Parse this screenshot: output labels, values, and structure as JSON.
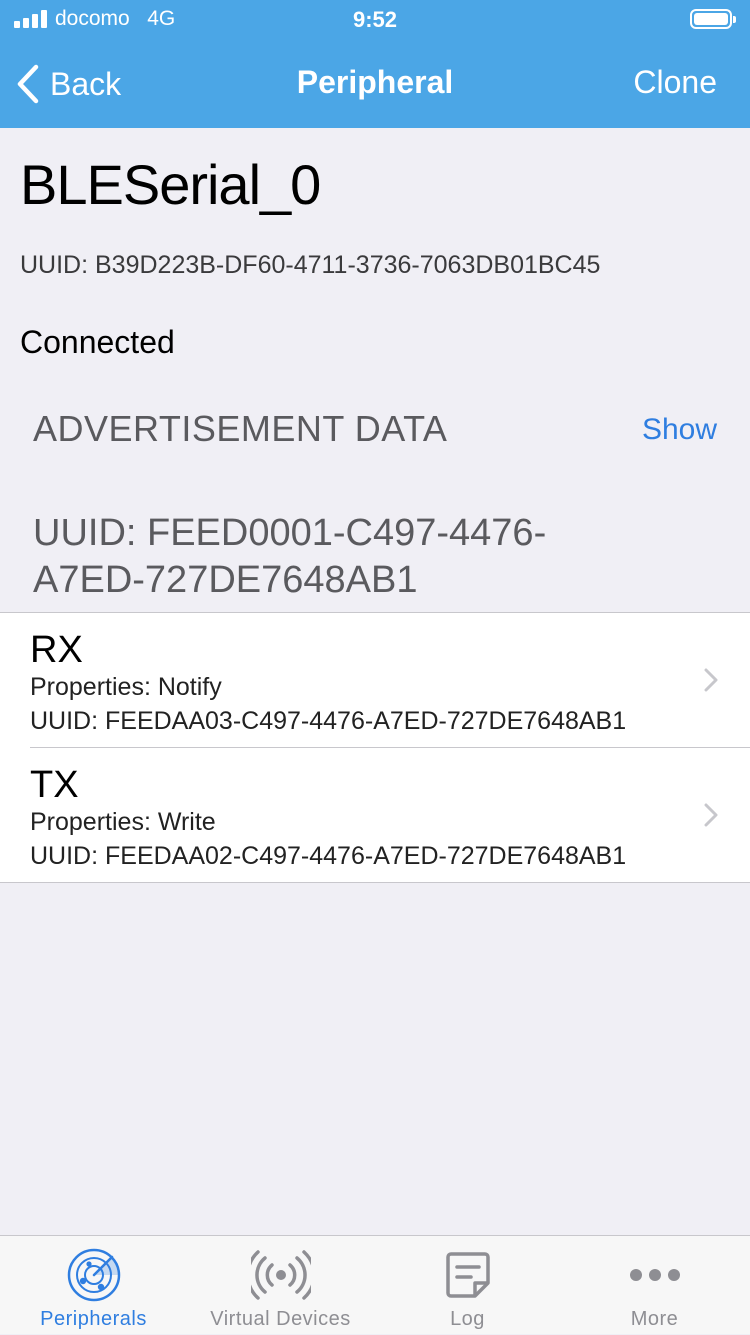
{
  "status_bar": {
    "carrier": "docomo",
    "network": "4G",
    "time": "9:52"
  },
  "nav": {
    "back_label": "Back",
    "title": "Peripheral",
    "clone_label": "Clone"
  },
  "peripheral": {
    "name": "BLESerial_0",
    "uuid": "UUID: B39D223B-DF60-4711-3736-7063DB01BC45",
    "state": "Connected"
  },
  "advertisement": {
    "label": "ADVERTISEMENT DATA",
    "show_label": "Show"
  },
  "service": {
    "uuid_line1": "UUID: FEED0001-C497-4476-",
    "uuid_line2": "A7ED-727DE7648AB1"
  },
  "characteristics": [
    {
      "name": "RX",
      "properties": "Properties: Notify",
      "uuid": "UUID: FEEDAA03-C497-4476-A7ED-727DE7648AB1"
    },
    {
      "name": "TX",
      "properties": "Properties: Write",
      "uuid": "UUID: FEEDAA02-C497-4476-A7ED-727DE7648AB1"
    }
  ],
  "tabs": [
    {
      "label": "Peripherals",
      "icon": "radar-icon",
      "active": true
    },
    {
      "label": "Virtual Devices",
      "icon": "broadcast-icon",
      "active": false
    },
    {
      "label": "Log",
      "icon": "log-icon",
      "active": false
    },
    {
      "label": "More",
      "icon": "more-dots-icon",
      "active": false
    }
  ],
  "colors": {
    "header": "#4ba6e6",
    "accent": "#2f7ee0",
    "background": "#f0eff5",
    "inactive_tab": "#8e8e93"
  }
}
